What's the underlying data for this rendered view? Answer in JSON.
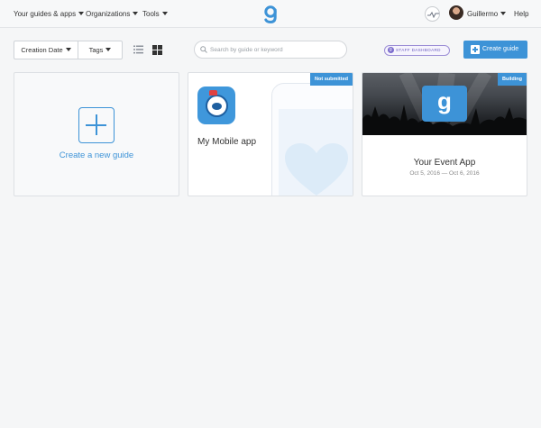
{
  "nav": {
    "guides_apps": "Your guides & apps",
    "organizations": "Organizations",
    "tools": "Tools",
    "logo_icon": "guidebook-g-icon",
    "username": "Guillermo",
    "help": "Help"
  },
  "toolbar": {
    "sort_label": "Creation Date",
    "tags_label": "Tags",
    "search_placeholder": "Search by guide or keyword",
    "staff_dashboard": "STAFF DASHBOARD",
    "create_guide": "Create guide"
  },
  "cards": {
    "new_guide": {
      "label": "Create a new guide"
    },
    "mobile": {
      "name": "My Mobile app",
      "badge": "Not submitted"
    },
    "event": {
      "name": "Your Event App",
      "badge": "Building",
      "dates": "Oct 5, 2016 — Oct 6, 2016"
    }
  },
  "colors": {
    "accent": "#3d93d7",
    "staff": "#6a5bbf",
    "background": "#f5f6f7"
  }
}
